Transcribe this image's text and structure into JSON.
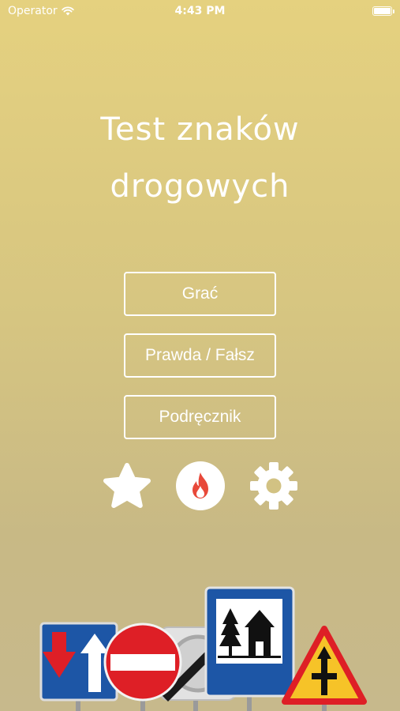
{
  "status_bar": {
    "carrier": "Operator",
    "time": "4:43 PM",
    "battery_percent": 100
  },
  "title": {
    "line1": "Test znaków",
    "line2": "drogowych"
  },
  "menu": {
    "play_label": "Grać",
    "true_false_label": "Prawda / Fałsz",
    "handbook_label": "Podręcznik"
  },
  "icons": {
    "favorites": "star-icon",
    "streak": "fire-icon",
    "settings": "gear-icon"
  },
  "colors": {
    "background_top": "#e5d17f",
    "background_bottom": "#c7b98c",
    "fire_accent": "#e8493a",
    "sign_blue": "#1d56a6",
    "sign_red": "#de1f26",
    "sign_yellow": "#f6c328"
  }
}
